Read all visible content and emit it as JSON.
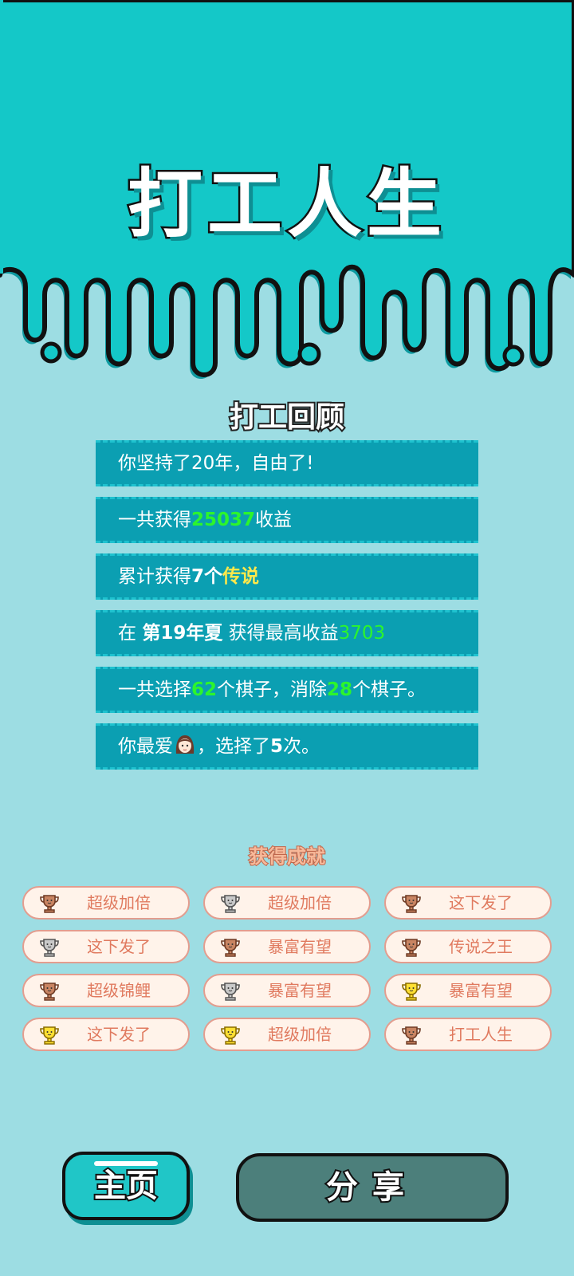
{
  "app_title": "打工人生",
  "review": {
    "title": "打工回顾",
    "rows": [
      {
        "text": "你坚持了20年，自由了!"
      },
      {
        "prefix": "一共获得",
        "amount": "25037",
        "suffix": "收益"
      },
      {
        "prefix": "累计获得",
        "count": "7个",
        "legend": "传说"
      },
      {
        "prefix": "在 ",
        "season": "第19年夏",
        "mid": " 获得最高收益",
        "amount": "3703"
      },
      {
        "prefix": "一共选择",
        "chosen": "62",
        "mid": "个棋子，消除",
        "removed": "28",
        "suffix": "个棋子。"
      },
      {
        "prefix": "你最爱",
        "mid": "，选择了",
        "times": "5",
        "suffix": "次。"
      }
    ]
  },
  "achievements": {
    "title": "获得成就",
    "items": [
      {
        "label": "超级加倍",
        "tier": "bronze"
      },
      {
        "label": "超级加倍",
        "tier": "silver"
      },
      {
        "label": "这下发了",
        "tier": "bronze"
      },
      {
        "label": "这下发了",
        "tier": "silver"
      },
      {
        "label": "暴富有望",
        "tier": "bronze"
      },
      {
        "label": "传说之王",
        "tier": "bronze"
      },
      {
        "label": "超级锦鲤",
        "tier": "bronze"
      },
      {
        "label": "暴富有望",
        "tier": "silver"
      },
      {
        "label": "暴富有望",
        "tier": "gold"
      },
      {
        "label": "这下发了",
        "tier": "gold"
      },
      {
        "label": "超级加倍",
        "tier": "gold"
      },
      {
        "label": "打工人生",
        "tier": "bronze"
      }
    ]
  },
  "buttons": {
    "home": "主页",
    "share": "分享"
  },
  "colors": {
    "header_bg": "#14c8c8",
    "page_bg": "#9ddde3",
    "row_bg": "#0b9fb2",
    "highlight_green": "#2cf52c",
    "highlight_yellow": "#ffe84a",
    "badge_text": "#e07a5f",
    "share_bg": "#4c7f7b"
  }
}
